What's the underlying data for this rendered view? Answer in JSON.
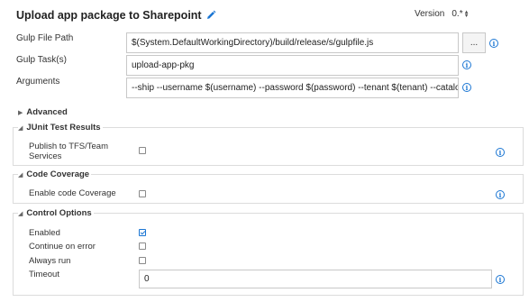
{
  "task": {
    "title": "Upload app package to Sharepoint",
    "version_label": "Version",
    "version_value": "0.*"
  },
  "fields": {
    "gulp_file_path": {
      "label": "Gulp File Path",
      "value": "$(System.DefaultWorkingDirectory)/build/release/s/gulpfile.js",
      "browse_label": "..."
    },
    "gulp_tasks": {
      "label": "Gulp Task(s)",
      "value": "upload-app-pkg"
    },
    "arguments": {
      "label": "Arguments",
      "value": "--ship --username $(username) --password $(password) --tenant $(tenant) --catalogsite $(catalogsite)"
    }
  },
  "sections": {
    "advanced": {
      "label": "Advanced"
    },
    "junit": {
      "label": "JUnit Test Results",
      "publish_label_line1": "Publish to TFS/Team",
      "publish_label_line2": "Services",
      "publish_checked": false
    },
    "coverage": {
      "label": "Code Coverage",
      "enable_label": "Enable code Coverage",
      "enable_checked": false
    },
    "control": {
      "label": "Control Options",
      "enabled_label": "Enabled",
      "enabled_checked": true,
      "continue_label": "Continue on error",
      "continue_checked": false,
      "always_label": "Always run",
      "always_checked": false,
      "timeout_label": "Timeout",
      "timeout_value": "0"
    }
  },
  "icons": {
    "info": "info-icon",
    "edit": "pencil-icon"
  },
  "colors": {
    "accent": "#1b76d3",
    "border": "#c8c8c8"
  }
}
